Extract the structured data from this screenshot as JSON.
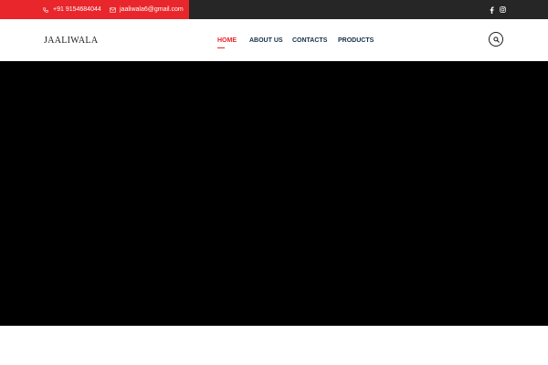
{
  "topbar": {
    "phone": "+91 9154684044",
    "email": "jaaliwala6@gmail.com",
    "phone_icon": "phone-icon",
    "email_icon": "envelope-icon",
    "social": [
      "facebook-icon",
      "instagram-icon"
    ]
  },
  "header": {
    "logo": "JAALIWALA",
    "nav": [
      "HOME",
      "ABOUT US",
      "CONTACTS",
      "PRODUCTS"
    ],
    "active_nav": "HOME",
    "search_icon": "search-icon"
  },
  "colors": {
    "accent": "#e8262b",
    "topbar_dark": "#262626",
    "nav_text": "#123048",
    "hero": "#000000"
  }
}
